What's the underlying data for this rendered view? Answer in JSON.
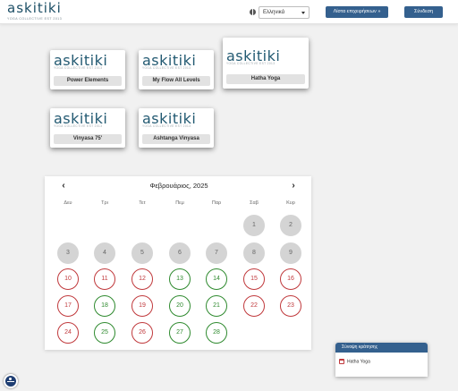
{
  "header": {
    "logo_text": "askitiki",
    "logo_tagline": "YOGA COLLECTIVE EST 2013",
    "language": "Ελληνικά",
    "list_button": "Λίστα επιχειρήσεων »",
    "login_button": "Σύνδεση"
  },
  "cards": [
    {
      "logo": "askitiki",
      "tagline": "YOGA COLLECTIVE EST 2013",
      "label": "Power Elements"
    },
    {
      "logo": "askitiki",
      "tagline": "YOGA COLLECTIVE EST 2013",
      "label": "My Flow All Levels"
    },
    {
      "logo": "askitiki",
      "tagline": "YOGA COLLECTIVE EST 2013",
      "label": "Hatha Yoga"
    },
    {
      "logo": "askitiki",
      "tagline": "YOGA COLLECTIVE EST 2013",
      "label": "Vinyasa 75'"
    },
    {
      "logo": "askitiki",
      "tagline": "YOGA COLLECTIVE EST 2013",
      "label": "Ashtanga Vinyasa"
    }
  ],
  "calendar": {
    "prev": "‹",
    "next": "›",
    "title": "Φεβρουάριος, 2025",
    "weekdays": [
      "Δευ",
      "Τρι",
      "Τετ",
      "Πεμ",
      "Παρ",
      "Σαβ",
      "Κυρ"
    ],
    "days": [
      {
        "n": "1",
        "status": "past"
      },
      {
        "n": "2",
        "status": "past"
      },
      {
        "n": "3",
        "status": "past"
      },
      {
        "n": "4",
        "status": "past"
      },
      {
        "n": "5",
        "status": "past"
      },
      {
        "n": "6",
        "status": "past"
      },
      {
        "n": "7",
        "status": "past"
      },
      {
        "n": "8",
        "status": "past"
      },
      {
        "n": "9",
        "status": "past"
      },
      {
        "n": "10",
        "status": "full"
      },
      {
        "n": "11",
        "status": "full"
      },
      {
        "n": "12",
        "status": "full"
      },
      {
        "n": "13",
        "status": "open"
      },
      {
        "n": "14",
        "status": "open"
      },
      {
        "n": "15",
        "status": "full"
      },
      {
        "n": "16",
        "status": "full"
      },
      {
        "n": "17",
        "status": "full"
      },
      {
        "n": "18",
        "status": "open"
      },
      {
        "n": "19",
        "status": "full"
      },
      {
        "n": "20",
        "status": "open"
      },
      {
        "n": "21",
        "status": "open"
      },
      {
        "n": "22",
        "status": "full"
      },
      {
        "n": "23",
        "status": "full"
      },
      {
        "n": "24",
        "status": "full"
      },
      {
        "n": "25",
        "status": "open"
      },
      {
        "n": "26",
        "status": "full"
      },
      {
        "n": "27",
        "status": "open"
      },
      {
        "n": "28",
        "status": "open"
      }
    ]
  },
  "summary": {
    "title": "Σύνοψη κράτησης",
    "item": "Hatha Yoga"
  },
  "colors": {
    "brand": "#34608e",
    "available": "#2f8a2f",
    "unavailable": "#c0393c",
    "past": "#d4d4d4"
  },
  "icons": [
    "globe-icon",
    "chevron-left-icon",
    "chevron-right-icon",
    "calendar-icon",
    "accessibility-icon"
  ]
}
